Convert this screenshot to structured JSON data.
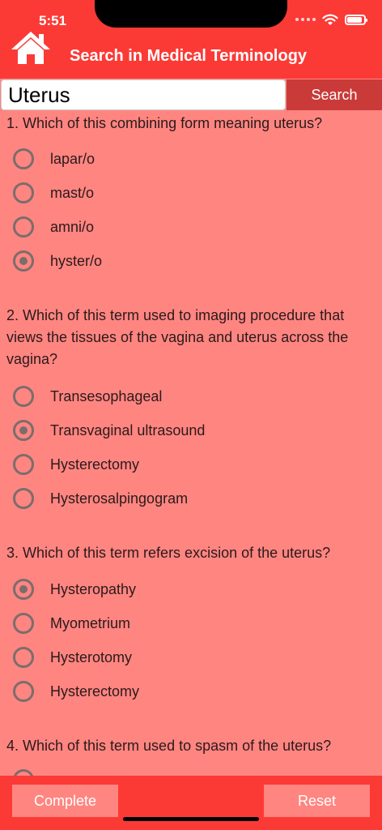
{
  "status_bar": {
    "time": "5:51"
  },
  "header": {
    "title": "Search in Medical Terminology",
    "home_icon": "home-icon"
  },
  "search": {
    "value": "Uterus",
    "button_label": "Search"
  },
  "questions": [
    {
      "text": "1. Which of this combining form meaning uterus?",
      "options": [
        {
          "label": "lapar/o",
          "selected": false
        },
        {
          "label": "mast/o",
          "selected": false
        },
        {
          "label": "amni/o",
          "selected": false
        },
        {
          "label": "hyster/o",
          "selected": true
        }
      ]
    },
    {
      "text": "2. Which of this term used to imaging procedure that views the tissues of the vagina and uterus across the vagina?",
      "options": [
        {
          "label": "Transesophageal",
          "selected": false
        },
        {
          "label": "Transvaginal ultrasound",
          "selected": true
        },
        {
          "label": "Hysterectomy",
          "selected": false
        },
        {
          "label": "Hysterosalpingogram",
          "selected": false
        }
      ]
    },
    {
      "text": "3. Which of this term refers excision of the uterus?",
      "options": [
        {
          "label": "Hysteropathy",
          "selected": true
        },
        {
          "label": "Myometrium",
          "selected": false
        },
        {
          "label": "Hysterotomy",
          "selected": false
        },
        {
          "label": "Hysterectomy",
          "selected": false
        }
      ]
    },
    {
      "text": "4. Which of this term used to spasm of the uterus?",
      "options": [
        {
          "label": "",
          "selected": false
        }
      ]
    }
  ],
  "footer": {
    "complete_label": "Complete",
    "reset_label": "Reset"
  },
  "colors": {
    "header": "#fb3a36",
    "background": "#ff8581",
    "search_button": "#c93a38"
  }
}
